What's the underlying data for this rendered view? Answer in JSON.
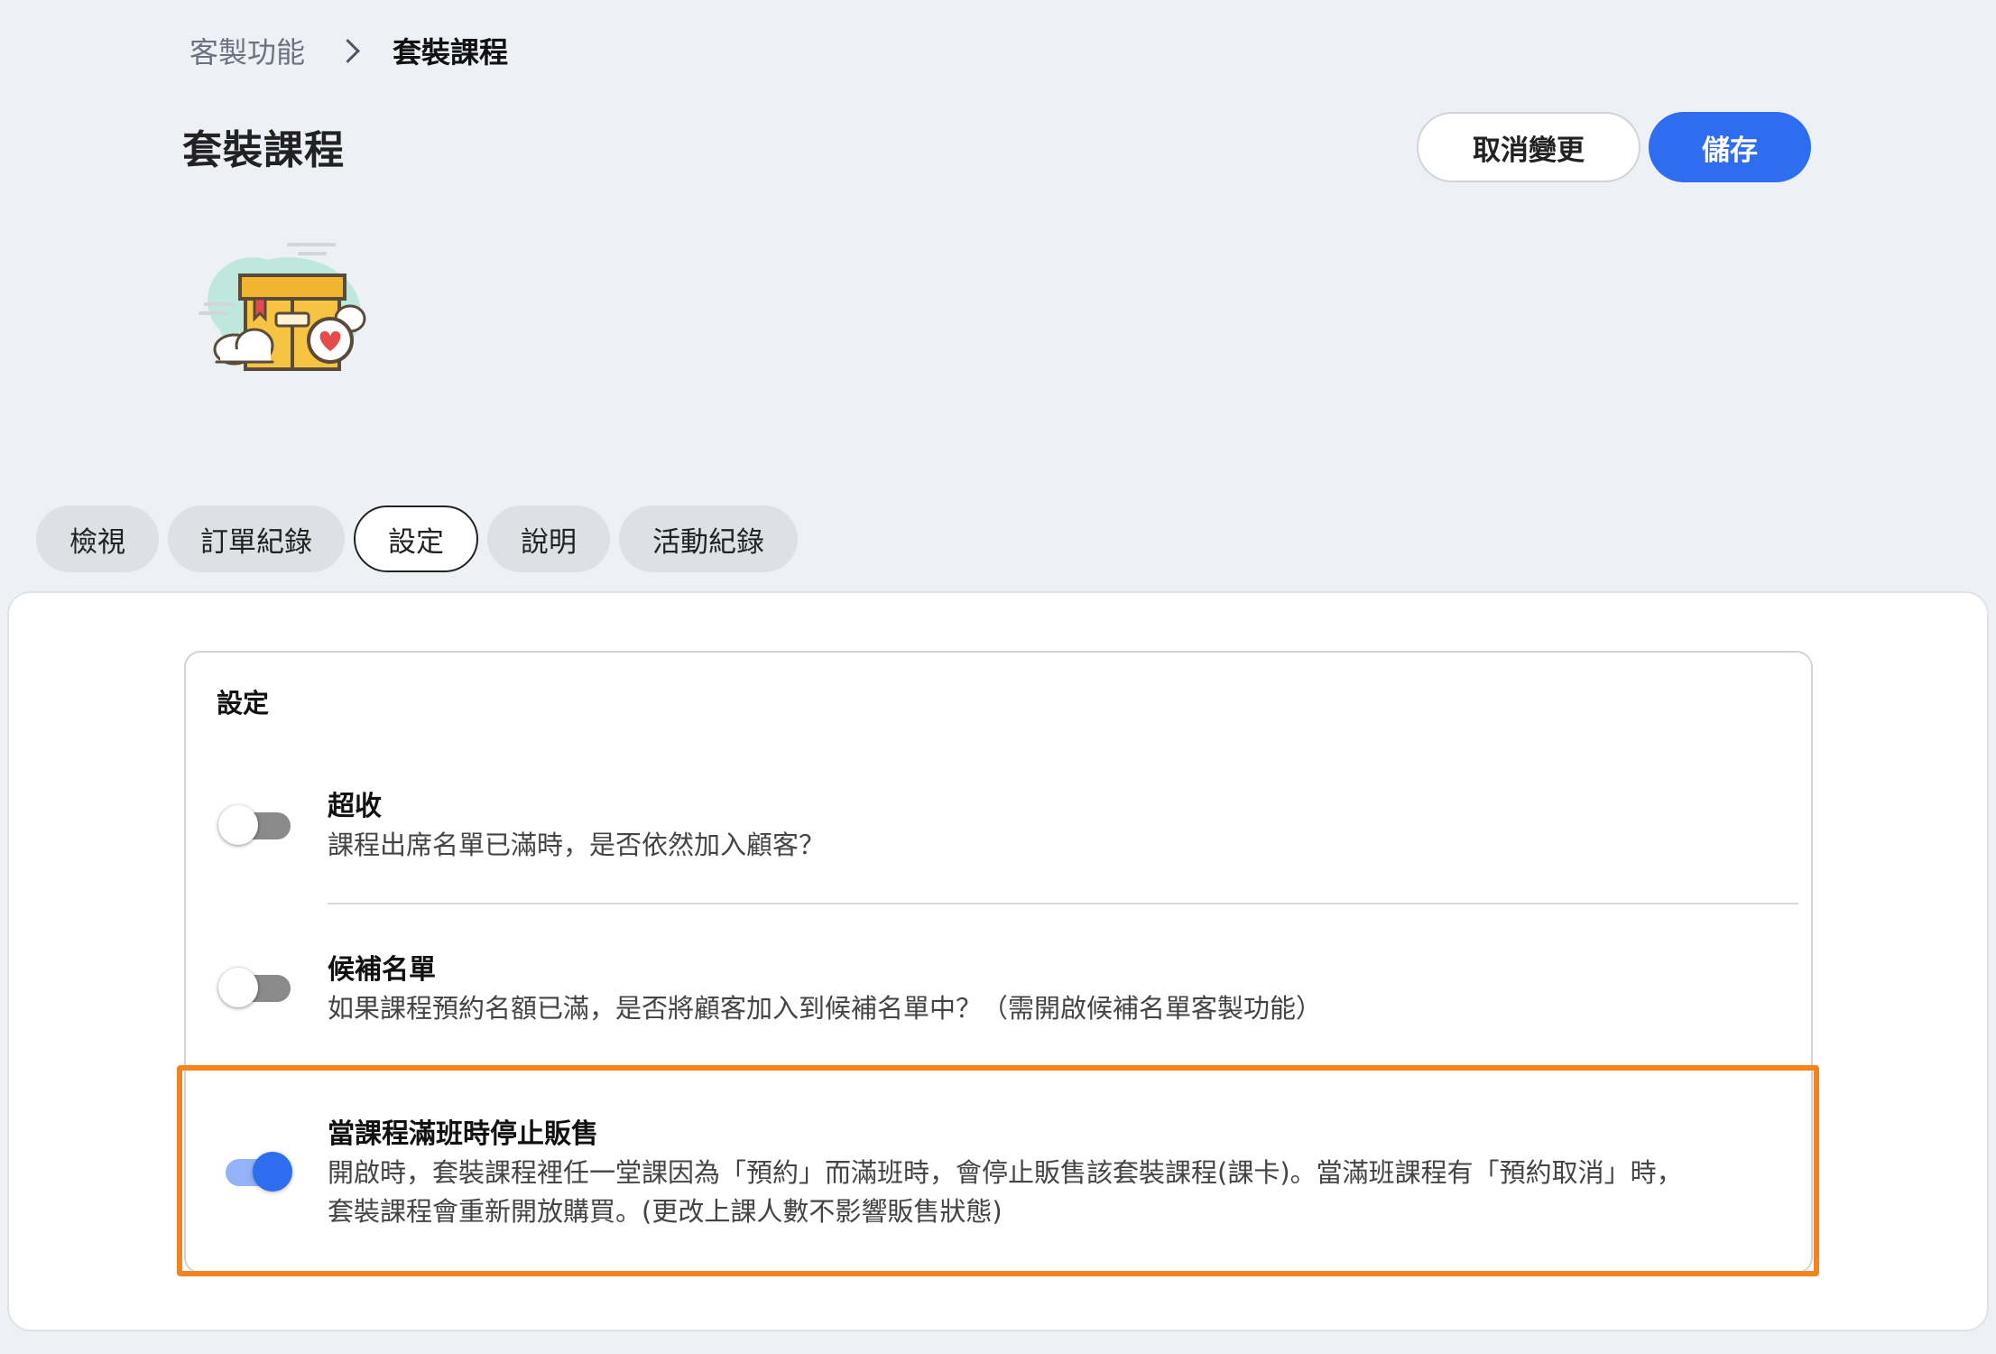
{
  "breadcrumb": {
    "parent": "客製功能",
    "current": "套裝課程"
  },
  "header": {
    "title": "套裝課程",
    "cancel_label": "取消變更",
    "save_label": "儲存"
  },
  "colors": {
    "accent": "#2f6df0",
    "highlight": "#f5841f",
    "background": "#edf0f5"
  },
  "tabs": [
    {
      "label": "檢視",
      "active": false
    },
    {
      "label": "訂單紀錄",
      "active": false
    },
    {
      "label": "設定",
      "active": true
    },
    {
      "label": "說明",
      "active": false
    },
    {
      "label": "活動紀錄",
      "active": false
    }
  ],
  "settings_card": {
    "title": "設定",
    "items": [
      {
        "title": "超收",
        "description_lines": [
          "課程出席名單已滿時，是否依然加入顧客？"
        ],
        "enabled": false
      },
      {
        "title": "候補名單",
        "description_lines": [
          "如果課程預約名額已滿，是否將顧客加入到候補名單中？（需開啟候補名單客製功能）"
        ],
        "enabled": false
      },
      {
        "title": "當課程滿班時停止販售",
        "description_lines": [
          "開啟時，套裝課程裡任一堂課因為「預約」而滿班時，會停止販售該套裝課程(課卡)。當滿班課程有「預約取消」時，",
          "套裝課程會重新開放購買。(更改上課人數不影響販售狀態)"
        ],
        "enabled": true,
        "highlighted": true
      }
    ]
  }
}
